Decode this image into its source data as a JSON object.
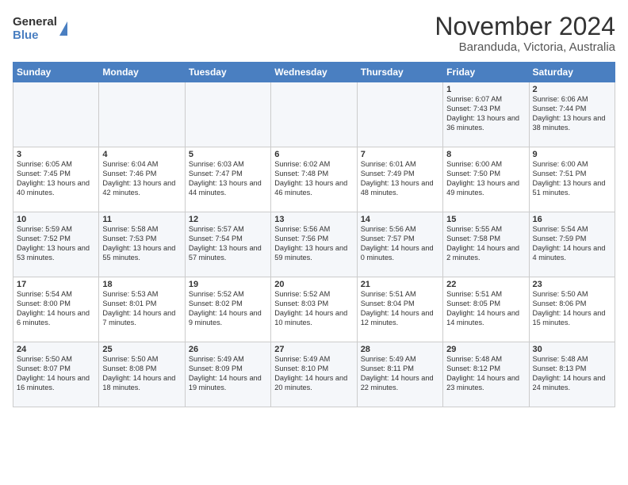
{
  "logo": {
    "general": "General",
    "blue": "Blue"
  },
  "header": {
    "month": "November 2024",
    "location": "Baranduda, Victoria, Australia"
  },
  "days_of_week": [
    "Sunday",
    "Monday",
    "Tuesday",
    "Wednesday",
    "Thursday",
    "Friday",
    "Saturday"
  ],
  "weeks": [
    [
      {
        "day": "",
        "info": ""
      },
      {
        "day": "",
        "info": ""
      },
      {
        "day": "",
        "info": ""
      },
      {
        "day": "",
        "info": ""
      },
      {
        "day": "",
        "info": ""
      },
      {
        "day": "1",
        "info": "Sunrise: 6:07 AM\nSunset: 7:43 PM\nDaylight: 13 hours and 36 minutes."
      },
      {
        "day": "2",
        "info": "Sunrise: 6:06 AM\nSunset: 7:44 PM\nDaylight: 13 hours and 38 minutes."
      }
    ],
    [
      {
        "day": "3",
        "info": "Sunrise: 6:05 AM\nSunset: 7:45 PM\nDaylight: 13 hours and 40 minutes."
      },
      {
        "day": "4",
        "info": "Sunrise: 6:04 AM\nSunset: 7:46 PM\nDaylight: 13 hours and 42 minutes."
      },
      {
        "day": "5",
        "info": "Sunrise: 6:03 AM\nSunset: 7:47 PM\nDaylight: 13 hours and 44 minutes."
      },
      {
        "day": "6",
        "info": "Sunrise: 6:02 AM\nSunset: 7:48 PM\nDaylight: 13 hours and 46 minutes."
      },
      {
        "day": "7",
        "info": "Sunrise: 6:01 AM\nSunset: 7:49 PM\nDaylight: 13 hours and 48 minutes."
      },
      {
        "day": "8",
        "info": "Sunrise: 6:00 AM\nSunset: 7:50 PM\nDaylight: 13 hours and 49 minutes."
      },
      {
        "day": "9",
        "info": "Sunrise: 6:00 AM\nSunset: 7:51 PM\nDaylight: 13 hours and 51 minutes."
      }
    ],
    [
      {
        "day": "10",
        "info": "Sunrise: 5:59 AM\nSunset: 7:52 PM\nDaylight: 13 hours and 53 minutes."
      },
      {
        "day": "11",
        "info": "Sunrise: 5:58 AM\nSunset: 7:53 PM\nDaylight: 13 hours and 55 minutes."
      },
      {
        "day": "12",
        "info": "Sunrise: 5:57 AM\nSunset: 7:54 PM\nDaylight: 13 hours and 57 minutes."
      },
      {
        "day": "13",
        "info": "Sunrise: 5:56 AM\nSunset: 7:56 PM\nDaylight: 13 hours and 59 minutes."
      },
      {
        "day": "14",
        "info": "Sunrise: 5:56 AM\nSunset: 7:57 PM\nDaylight: 14 hours and 0 minutes."
      },
      {
        "day": "15",
        "info": "Sunrise: 5:55 AM\nSunset: 7:58 PM\nDaylight: 14 hours and 2 minutes."
      },
      {
        "day": "16",
        "info": "Sunrise: 5:54 AM\nSunset: 7:59 PM\nDaylight: 14 hours and 4 minutes."
      }
    ],
    [
      {
        "day": "17",
        "info": "Sunrise: 5:54 AM\nSunset: 8:00 PM\nDaylight: 14 hours and 6 minutes."
      },
      {
        "day": "18",
        "info": "Sunrise: 5:53 AM\nSunset: 8:01 PM\nDaylight: 14 hours and 7 minutes."
      },
      {
        "day": "19",
        "info": "Sunrise: 5:52 AM\nSunset: 8:02 PM\nDaylight: 14 hours and 9 minutes."
      },
      {
        "day": "20",
        "info": "Sunrise: 5:52 AM\nSunset: 8:03 PM\nDaylight: 14 hours and 10 minutes."
      },
      {
        "day": "21",
        "info": "Sunrise: 5:51 AM\nSunset: 8:04 PM\nDaylight: 14 hours and 12 minutes."
      },
      {
        "day": "22",
        "info": "Sunrise: 5:51 AM\nSunset: 8:05 PM\nDaylight: 14 hours and 14 minutes."
      },
      {
        "day": "23",
        "info": "Sunrise: 5:50 AM\nSunset: 8:06 PM\nDaylight: 14 hours and 15 minutes."
      }
    ],
    [
      {
        "day": "24",
        "info": "Sunrise: 5:50 AM\nSunset: 8:07 PM\nDaylight: 14 hours and 16 minutes."
      },
      {
        "day": "25",
        "info": "Sunrise: 5:50 AM\nSunset: 8:08 PM\nDaylight: 14 hours and 18 minutes."
      },
      {
        "day": "26",
        "info": "Sunrise: 5:49 AM\nSunset: 8:09 PM\nDaylight: 14 hours and 19 minutes."
      },
      {
        "day": "27",
        "info": "Sunrise: 5:49 AM\nSunset: 8:10 PM\nDaylight: 14 hours and 20 minutes."
      },
      {
        "day": "28",
        "info": "Sunrise: 5:49 AM\nSunset: 8:11 PM\nDaylight: 14 hours and 22 minutes."
      },
      {
        "day": "29",
        "info": "Sunrise: 5:48 AM\nSunset: 8:12 PM\nDaylight: 14 hours and 23 minutes."
      },
      {
        "day": "30",
        "info": "Sunrise: 5:48 AM\nSunset: 8:13 PM\nDaylight: 14 hours and 24 minutes."
      }
    ]
  ]
}
